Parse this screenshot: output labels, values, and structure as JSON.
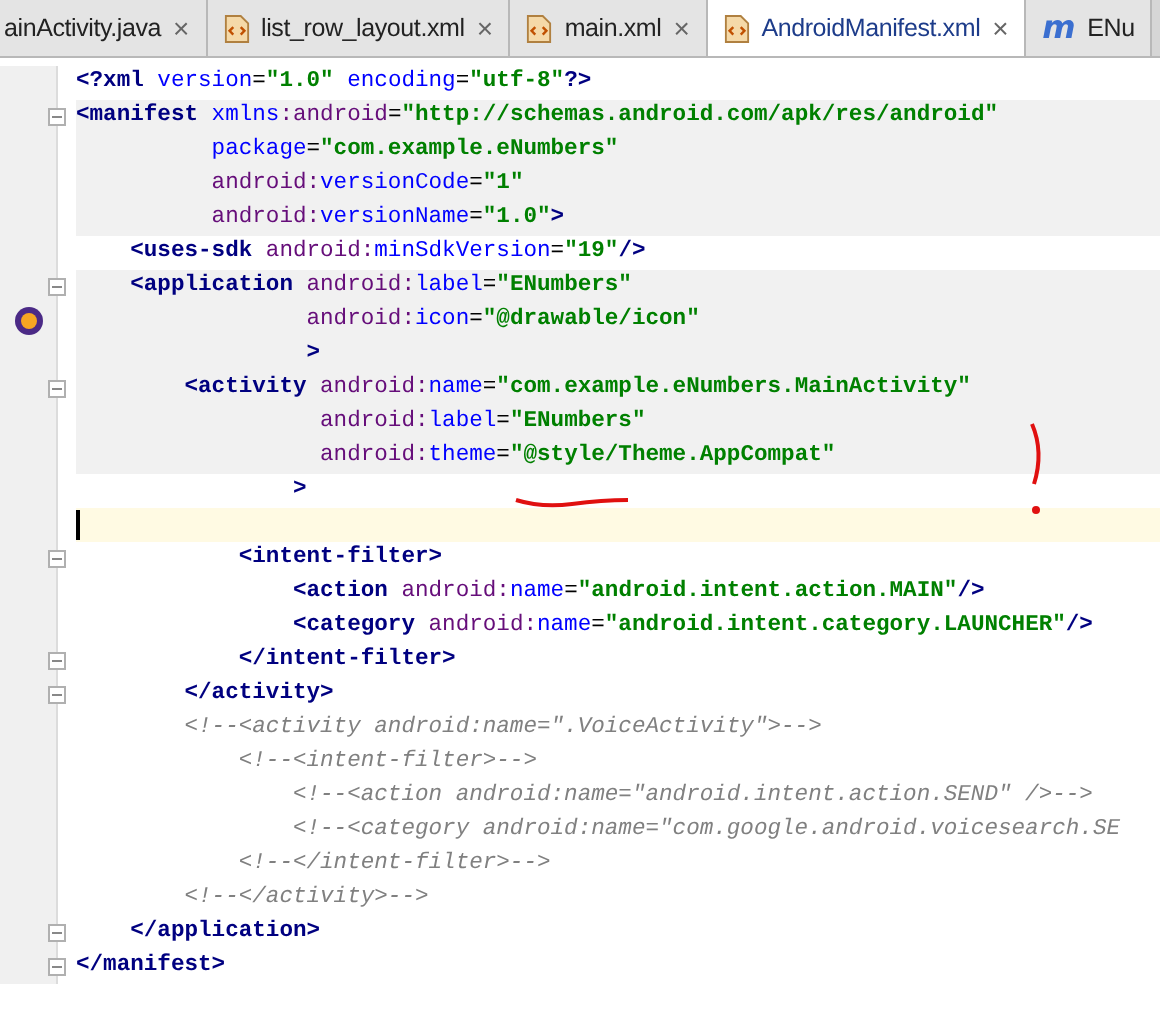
{
  "tabs": [
    {
      "label": "ainActivity.java",
      "kind": "plain",
      "selected": false,
      "closable": true
    },
    {
      "label": "list_row_layout.xml",
      "kind": "xml",
      "selected": false,
      "closable": true
    },
    {
      "label": "main.xml",
      "kind": "xml",
      "selected": false,
      "closable": true
    },
    {
      "label": "AndroidManifest.xml",
      "kind": "xml",
      "selected": true,
      "closable": true
    },
    {
      "label": "ENu",
      "kind": "class",
      "selected": false,
      "closable": false
    }
  ],
  "close_glyph": "×",
  "class_icon_glyph": "m",
  "lines": [
    {
      "fold": false,
      "marker": false,
      "highlighted": false,
      "current": false,
      "tokens": [
        {
          "kind": "tag",
          "t": "<?xml"
        },
        {
          "kind": "attr",
          "t": " version"
        },
        {
          "kind": "eq",
          "t": "="
        },
        {
          "kind": "value",
          "t": "\"1.0\""
        },
        {
          "kind": "attr",
          "t": " encoding"
        },
        {
          "kind": "eq",
          "t": "="
        },
        {
          "kind": "value",
          "t": "\"utf-8\""
        },
        {
          "kind": "tag",
          "t": "?>"
        }
      ]
    },
    {
      "fold": true,
      "marker": false,
      "highlighted": true,
      "current": false,
      "tokens": [
        {
          "kind": "tag",
          "t": "<manifest"
        },
        {
          "kind": "attr",
          "t": " xmlns"
        },
        {
          "kind": "ns",
          "t": ":android"
        },
        {
          "kind": "eq",
          "t": "="
        },
        {
          "kind": "value",
          "t": "\"http://schemas.android.com/apk/res/android\""
        }
      ]
    },
    {
      "fold": false,
      "marker": false,
      "highlighted": true,
      "current": false,
      "tokens": [
        {
          "kind": "attr",
          "t": "          package"
        },
        {
          "kind": "eq",
          "t": "="
        },
        {
          "kind": "value",
          "t": "\"com.example.eNumbers\""
        }
      ]
    },
    {
      "fold": false,
      "marker": false,
      "highlighted": true,
      "current": false,
      "tokens": [
        {
          "kind": "ns",
          "t": "          android:"
        },
        {
          "kind": "attr",
          "t": "versionCode"
        },
        {
          "kind": "eq",
          "t": "="
        },
        {
          "kind": "value",
          "t": "\"1\""
        }
      ]
    },
    {
      "fold": false,
      "marker": false,
      "highlighted": true,
      "current": false,
      "tokens": [
        {
          "kind": "ns",
          "t": "          android:"
        },
        {
          "kind": "attr",
          "t": "versionName"
        },
        {
          "kind": "eq",
          "t": "="
        },
        {
          "kind": "value",
          "t": "\"1.0\""
        },
        {
          "kind": "tag",
          "t": ">"
        }
      ]
    },
    {
      "fold": false,
      "marker": false,
      "highlighted": false,
      "current": false,
      "tokens": [
        {
          "kind": "tag",
          "t": "    <uses-sdk"
        },
        {
          "kind": "ns",
          "t": " android:"
        },
        {
          "kind": "attr",
          "t": "minSdkVersion"
        },
        {
          "kind": "eq",
          "t": "="
        },
        {
          "kind": "value",
          "t": "\"19\""
        },
        {
          "kind": "tag",
          "t": "/>"
        }
      ]
    },
    {
      "fold": true,
      "marker": false,
      "highlighted": true,
      "current": false,
      "tokens": [
        {
          "kind": "tag",
          "t": "    <application"
        },
        {
          "kind": "ns",
          "t": " android:"
        },
        {
          "kind": "attr",
          "t": "label"
        },
        {
          "kind": "eq",
          "t": "="
        },
        {
          "kind": "value",
          "t": "\"ENumbers\""
        }
      ]
    },
    {
      "fold": false,
      "marker": true,
      "highlighted": true,
      "current": false,
      "tokens": [
        {
          "kind": "ns",
          "t": "                 android:"
        },
        {
          "kind": "attr",
          "t": "icon"
        },
        {
          "kind": "eq",
          "t": "="
        },
        {
          "kind": "value",
          "t": "\"@drawable/icon\""
        }
      ]
    },
    {
      "fold": false,
      "marker": false,
      "highlighted": true,
      "current": false,
      "tokens": [
        {
          "kind": "tag",
          "t": "                 >"
        }
      ]
    },
    {
      "fold": true,
      "marker": false,
      "highlighted": true,
      "current": false,
      "tokens": [
        {
          "kind": "tag",
          "t": "        <activity"
        },
        {
          "kind": "ns",
          "t": " android:"
        },
        {
          "kind": "attr",
          "t": "name"
        },
        {
          "kind": "eq",
          "t": "="
        },
        {
          "kind": "value",
          "t": "\"com.example.eNumbers.MainActivity\""
        }
      ]
    },
    {
      "fold": false,
      "marker": false,
      "highlighted": true,
      "current": false,
      "tokens": [
        {
          "kind": "ns",
          "t": "                  android:"
        },
        {
          "kind": "attr",
          "t": "label"
        },
        {
          "kind": "eq",
          "t": "="
        },
        {
          "kind": "value",
          "t": "\"ENumbers\""
        }
      ]
    },
    {
      "fold": false,
      "marker": false,
      "highlighted": true,
      "current": false,
      "tokens": [
        {
          "kind": "ns",
          "t": "                  android:"
        },
        {
          "kind": "attr",
          "t": "theme"
        },
        {
          "kind": "eq",
          "t": "="
        },
        {
          "kind": "value",
          "t": "\"@style/Theme.AppCompat\""
        }
      ]
    },
    {
      "fold": false,
      "marker": false,
      "highlighted": false,
      "current": false,
      "tokens": [
        {
          "kind": "tag",
          "t": "                >"
        }
      ]
    },
    {
      "fold": false,
      "marker": false,
      "highlighted": false,
      "current": true
    },
    {
      "fold": true,
      "marker": false,
      "highlighted": false,
      "current": false,
      "tokens": [
        {
          "kind": "tag",
          "t": "            <intent-filter>"
        }
      ]
    },
    {
      "fold": false,
      "marker": false,
      "highlighted": false,
      "current": false,
      "tokens": [
        {
          "kind": "tag",
          "t": "                <action"
        },
        {
          "kind": "ns",
          "t": " android:"
        },
        {
          "kind": "attr",
          "t": "name"
        },
        {
          "kind": "eq",
          "t": "="
        },
        {
          "kind": "value",
          "t": "\"android.intent.action.MAIN\""
        },
        {
          "kind": "tag",
          "t": "/>"
        }
      ]
    },
    {
      "fold": false,
      "marker": false,
      "highlighted": false,
      "current": false,
      "tokens": [
        {
          "kind": "tag",
          "t": "                <category"
        },
        {
          "kind": "ns",
          "t": " android:"
        },
        {
          "kind": "attr",
          "t": "name"
        },
        {
          "kind": "eq",
          "t": "="
        },
        {
          "kind": "value",
          "t": "\"android.intent.category.LAUNCHER\""
        },
        {
          "kind": "tag",
          "t": "/>"
        }
      ]
    },
    {
      "fold": true,
      "marker": false,
      "highlighted": false,
      "current": false,
      "tokens": [
        {
          "kind": "tag",
          "t": "            </intent-filter>"
        }
      ]
    },
    {
      "fold": true,
      "marker": false,
      "highlighted": false,
      "current": false,
      "tokens": [
        {
          "kind": "tag",
          "t": "        </activity>"
        }
      ]
    },
    {
      "fold": false,
      "marker": false,
      "highlighted": false,
      "current": false,
      "tokens": [
        {
          "kind": "comment",
          "t": "        <!--<activity android:name=\".VoiceActivity\">-->"
        }
      ]
    },
    {
      "fold": false,
      "marker": false,
      "highlighted": false,
      "current": false,
      "tokens": [
        {
          "kind": "comment",
          "t": "            <!--<intent-filter>-->"
        }
      ]
    },
    {
      "fold": false,
      "marker": false,
      "highlighted": false,
      "current": false,
      "tokens": [
        {
          "kind": "comment",
          "t": "                <!--<action android:name=\"android.intent.action.SEND\" />-->"
        }
      ]
    },
    {
      "fold": false,
      "marker": false,
      "highlighted": false,
      "current": false,
      "tokens": [
        {
          "kind": "comment",
          "t": "                <!--<category android:name=\"com.google.android.voicesearch.SE"
        }
      ]
    },
    {
      "fold": false,
      "marker": false,
      "highlighted": false,
      "current": false,
      "tokens": [
        {
          "kind": "comment",
          "t": "            <!--</intent-filter>-->"
        }
      ]
    },
    {
      "fold": false,
      "marker": false,
      "highlighted": false,
      "current": false,
      "tokens": [
        {
          "kind": "comment",
          "t": "        <!--</activity>-->"
        }
      ]
    },
    {
      "fold": true,
      "marker": false,
      "highlighted": false,
      "current": false,
      "tokens": [
        {
          "kind": "tag",
          "t": "    </application>"
        }
      ]
    },
    {
      "fold": true,
      "marker": false,
      "highlighted": false,
      "current": false,
      "tokens": [
        {
          "kind": "tag",
          "t": "</manifest>"
        }
      ]
    }
  ]
}
